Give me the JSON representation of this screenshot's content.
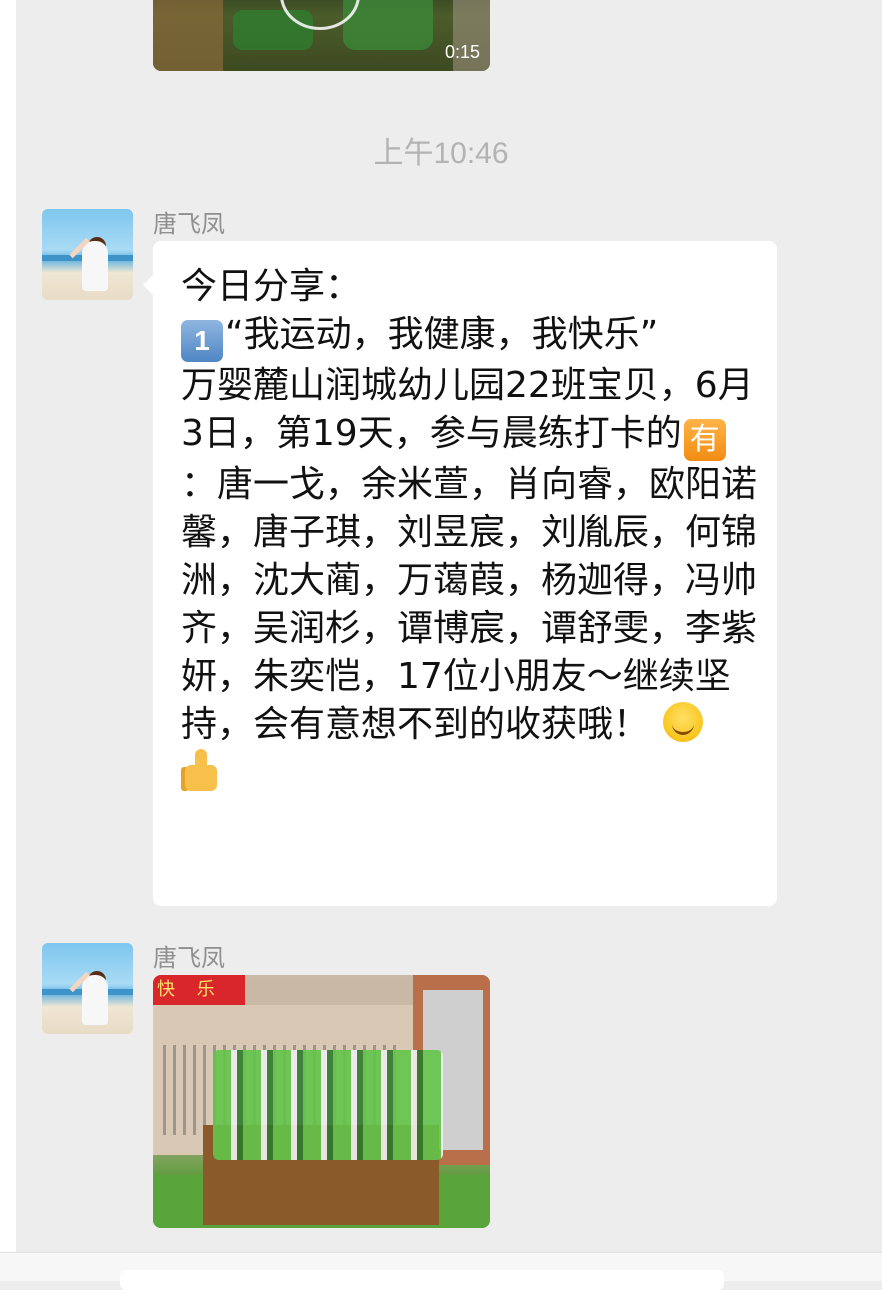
{
  "chat": {
    "video_duration": "0:15",
    "timestamp": "上午10:46",
    "messages": [
      {
        "sender": "唐飞凤",
        "type": "text",
        "line_1": "今日分享：",
        "badge_1": "1",
        "line_2": "“我运动，我健康，我快乐”",
        "line_3": "万婴麓山润城幼儿园22班宝贝，6月3日，第19天，参与晨练打卡的",
        "badge_you": "有",
        "line_4": "：唐一戈，余米萱，肖向睿，欧阳诺馨，唐子琪，刘昱宸，刘胤辰，何锦洲，沈大蔺，万蔼葭，杨迦得，冯帅齐，吴润杉，谭博宸，谭舒雯，李紫妍，朱奕恺，17位小朋友～继续坚持，会有意想不到的收获哦！",
        "emoji_1": "smile-emoji",
        "emoji_2": "thumbs-up-emoji"
      },
      {
        "sender": "唐飞凤",
        "type": "image",
        "banner_text": "快 乐"
      }
    ]
  },
  "colors": {
    "background": "#ededed",
    "bubble": "#ffffff",
    "timestamp": "#b3b3b3",
    "sender_name": "#8f8f8f"
  }
}
